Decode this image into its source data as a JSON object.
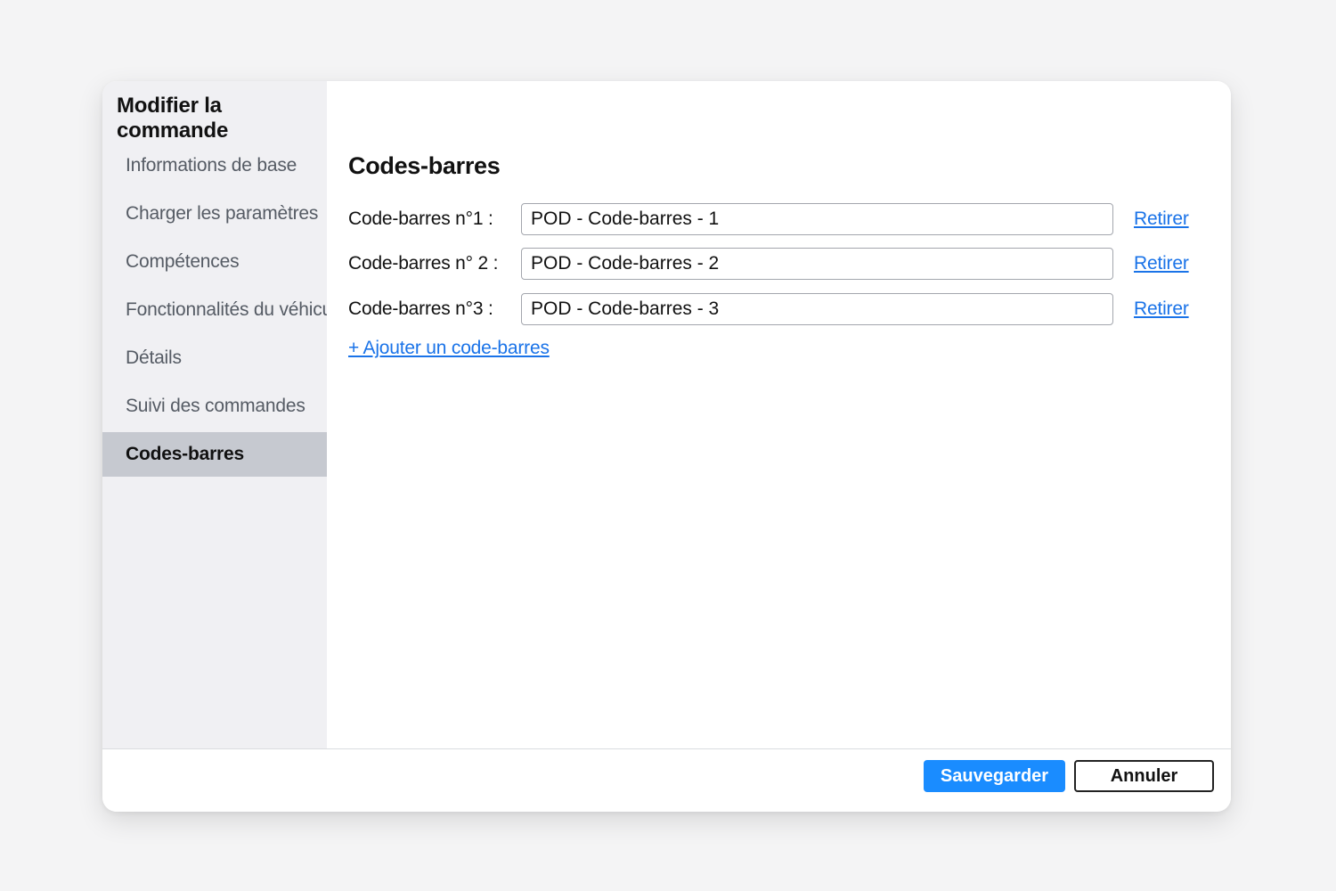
{
  "dialog": {
    "title": "Modifier la commande"
  },
  "sidebar": {
    "items": [
      {
        "label": "Informations de base"
      },
      {
        "label": "Charger les paramètres"
      },
      {
        "label": "Compétences"
      },
      {
        "label": "Fonctionnalités du véhicule"
      },
      {
        "label": "Détails"
      },
      {
        "label": "Suivi des commandes"
      },
      {
        "label": "Codes-barres",
        "active": true
      }
    ]
  },
  "main": {
    "section_title": "Codes-barres",
    "barcodes": [
      {
        "label": "Code-barres n°1 :",
        "value": "POD - Code-barres - 1",
        "remove_label": "Retirer"
      },
      {
        "label": "Code-barres n° 2 :",
        "value": "POD - Code-barres - 2",
        "remove_label": "Retirer"
      },
      {
        "label": "Code-barres n°3 :",
        "value": "POD - Code-barres - 3",
        "remove_label": "Retirer"
      }
    ],
    "add_label": "+ Ajouter un code-barres"
  },
  "footer": {
    "save_label": "Sauvegarder",
    "cancel_label": "Annuler"
  },
  "colors": {
    "accent": "#1a8cff",
    "link": "#1a73e8",
    "sidebar_bg": "#f0f0f3",
    "sidebar_active_bg": "#c6c9d0"
  }
}
